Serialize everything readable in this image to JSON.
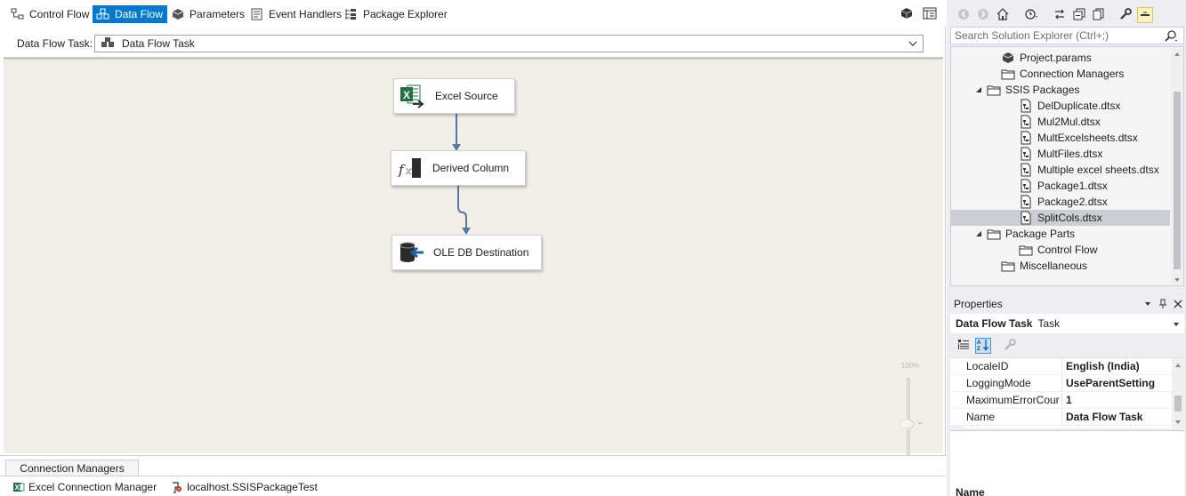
{
  "designer": {
    "tabs": [
      {
        "label": "Control Flow",
        "icon": "control-flow-icon",
        "active": false
      },
      {
        "label": "Data Flow",
        "icon": "data-flow-icon",
        "active": true
      },
      {
        "label": "Parameters",
        "icon": "parameters-icon",
        "active": false
      },
      {
        "label": "Event Handlers",
        "icon": "event-handlers-icon",
        "active": false
      },
      {
        "label": "Package Explorer",
        "icon": "package-explorer-icon",
        "active": false
      }
    ],
    "task_label": "Data Flow Task:",
    "task_value": "Data Flow Task",
    "components": [
      {
        "label": "Excel Source",
        "icon": "excel-source-icon"
      },
      {
        "label": "Derived Column",
        "icon": "derived-column-icon"
      },
      {
        "label": "OLE DB Destination",
        "icon": "ole-db-destination-icon"
      }
    ],
    "zoom": "100%"
  },
  "connection_managers": {
    "tab_label": "Connection Managers",
    "items": [
      {
        "label": "Excel Connection Manager",
        "icon": "excel-connection-icon"
      },
      {
        "label": "localhost.SSISPackageTest",
        "icon": "oledb-connection-icon"
      }
    ]
  },
  "solution_explorer": {
    "search_placeholder": "Search Solution Explorer (Ctrl+;)",
    "tree": [
      {
        "label": "Project.params",
        "icon": "params-icon",
        "expander": ""
      },
      {
        "label": "Connection Managers",
        "icon": "folder-icon",
        "expander": ""
      },
      {
        "label": "SSIS Packages",
        "icon": "folder-icon",
        "expander": "expanded"
      },
      {
        "label": "DelDuplicate.dtsx",
        "icon": "package-file-icon",
        "expander": ""
      },
      {
        "label": "Mul2Mul.dtsx",
        "icon": "package-file-icon",
        "expander": ""
      },
      {
        "label": "MultExcelsheets.dtsx",
        "icon": "package-file-icon",
        "expander": ""
      },
      {
        "label": "MultFiles.dtsx",
        "icon": "package-file-icon",
        "expander": ""
      },
      {
        "label": "Multiple excel sheets.dtsx",
        "icon": "package-file-icon",
        "expander": ""
      },
      {
        "label": "Package1.dtsx",
        "icon": "package-file-icon",
        "expander": ""
      },
      {
        "label": "Package2.dtsx",
        "icon": "package-file-icon",
        "expander": ""
      },
      {
        "label": "SplitCols.dtsx",
        "icon": "package-file-icon",
        "expander": "",
        "selected": true
      },
      {
        "label": "Package Parts",
        "icon": "folder-icon",
        "expander": "expanded"
      },
      {
        "label": "Control Flow",
        "icon": "folder-icon",
        "expander": ""
      },
      {
        "label": "Miscellaneous",
        "icon": "folder-icon",
        "expander": ""
      }
    ]
  },
  "properties": {
    "title": "Properties",
    "object_name": "Data Flow Task",
    "object_type": "Task",
    "rows": [
      {
        "name": "LocaleID",
        "value": "English (India)"
      },
      {
        "name": "LoggingMode",
        "value": "UseParentSetting"
      },
      {
        "name": "MaximumErrorCour",
        "value": "1"
      },
      {
        "name": "Name",
        "value": "Data Flow Task"
      }
    ],
    "description_name": "Name"
  }
}
